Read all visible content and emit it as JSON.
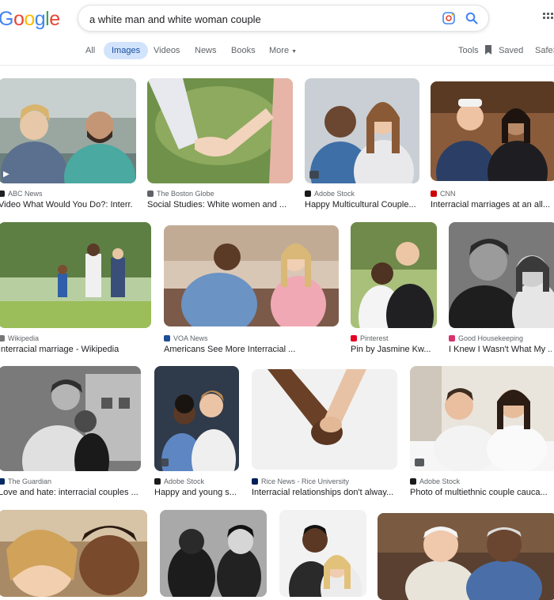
{
  "logo": {
    "letters": [
      "G",
      "o",
      "o",
      "g",
      "l",
      "e"
    ],
    "colors": [
      "#4285f4",
      "#ea4335",
      "#fbbc05",
      "#4285f4",
      "#34a853",
      "#ea4335"
    ]
  },
  "search": {
    "query": "a white man and white woman couple"
  },
  "tabs": {
    "all": "All",
    "images": "Images",
    "videos": "Videos",
    "news": "News",
    "books": "Books",
    "more": "More",
    "tools": "Tools",
    "saved": "Saved",
    "safesearch": "SafeS"
  },
  "results": [
    {
      "source": "ABC News",
      "caption": "Video What Would You Do?: Interr...",
      "favicon_color": "#202124",
      "video": true
    },
    {
      "source": "The Boston Globe",
      "caption": "Social Studies: White women and ...",
      "favicon_color": "#5f6368"
    },
    {
      "source": "Adobe Stock",
      "caption": "Happy Multicultural Couple...",
      "favicon_color": "#1a1a1a",
      "badge": true
    },
    {
      "source": "CNN",
      "caption": "Interracial marriages at an all...",
      "favicon_color": "#cc0000"
    },
    {
      "source": "Wikipedia",
      "caption": "Interracial marriage - Wikipedia",
      "favicon_color": "#777777"
    },
    {
      "source": "VOA News",
      "caption": "Americans See More Interracial ...",
      "favicon_color": "#1f4e96"
    },
    {
      "source": "Pinterest",
      "caption": "Pin by Jasmine Kw...",
      "favicon_color": "#e60023"
    },
    {
      "source": "Good Housekeeping",
      "caption": "I Knew I Wasn't What My ...",
      "favicon_color": "#d6336c"
    },
    {
      "source": "The Guardian",
      "caption": "Love and hate: interracial couples ...",
      "favicon_color": "#052962"
    },
    {
      "source": "Adobe Stock",
      "caption": "Happy and young s...",
      "favicon_color": "#1a1a1a",
      "badge": true
    },
    {
      "source": "Rice News - Rice University",
      "caption": "Interracial relationships don't alway...",
      "favicon_color": "#00205b"
    },
    {
      "source": "Adobe Stock",
      "caption": "Photo of multiethnic couple cauca...",
      "favicon_color": "#1a1a1a",
      "badge": true
    },
    {
      "source": "",
      "caption": ""
    },
    {
      "source": "",
      "caption": ""
    },
    {
      "source": "",
      "caption": ""
    },
    {
      "source": "",
      "caption": ""
    }
  ]
}
